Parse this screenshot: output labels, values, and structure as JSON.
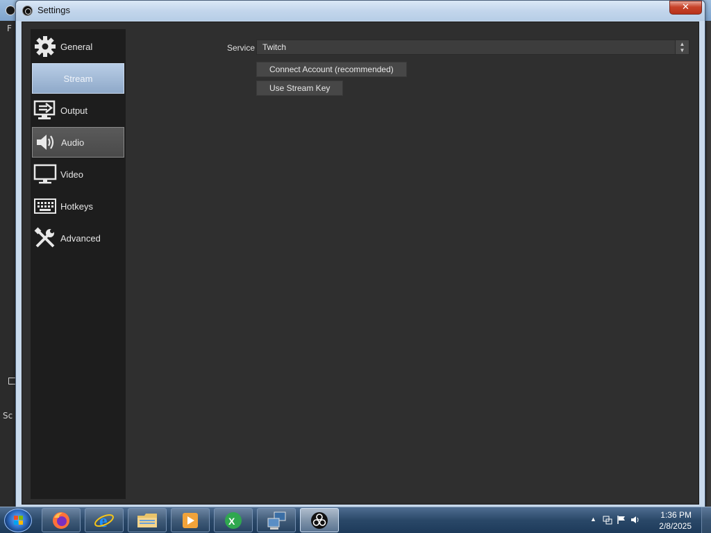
{
  "window": {
    "title": "Settings",
    "close_label": "✕"
  },
  "background": {
    "left_fragments": [
      "F",
      "Sc"
    ]
  },
  "sidebar": {
    "items": [
      {
        "label": "General",
        "icon": "gear-icon",
        "state": "normal"
      },
      {
        "label": "Stream",
        "icon": "globe-icon",
        "state": "selected"
      },
      {
        "label": "Output",
        "icon": "output-icon",
        "state": "normal"
      },
      {
        "label": "Audio",
        "icon": "speaker-icon",
        "state": "hover"
      },
      {
        "label": "Video",
        "icon": "monitor-icon",
        "state": "normal"
      },
      {
        "label": "Hotkeys",
        "icon": "keyboard-icon",
        "state": "normal"
      },
      {
        "label": "Advanced",
        "icon": "tools-icon",
        "state": "normal"
      }
    ]
  },
  "stream": {
    "service_label": "Service",
    "service_value": "Twitch",
    "connect_button": "Connect Account (recommended)",
    "stream_key_button": "Use Stream Key"
  },
  "taskbar": {
    "apps": [
      "firefox-icon",
      "internet-explorer-icon",
      "file-explorer-icon",
      "media-player-icon",
      "excel-icon",
      "network-icon",
      "obs-icon"
    ],
    "time": "1:36 PM",
    "date": "2/8/2025"
  },
  "colors": {
    "accent_selected": "#a9c1e0",
    "panel_bg": "#2f2f2f",
    "sidebar_bg": "#1d1d1d"
  }
}
